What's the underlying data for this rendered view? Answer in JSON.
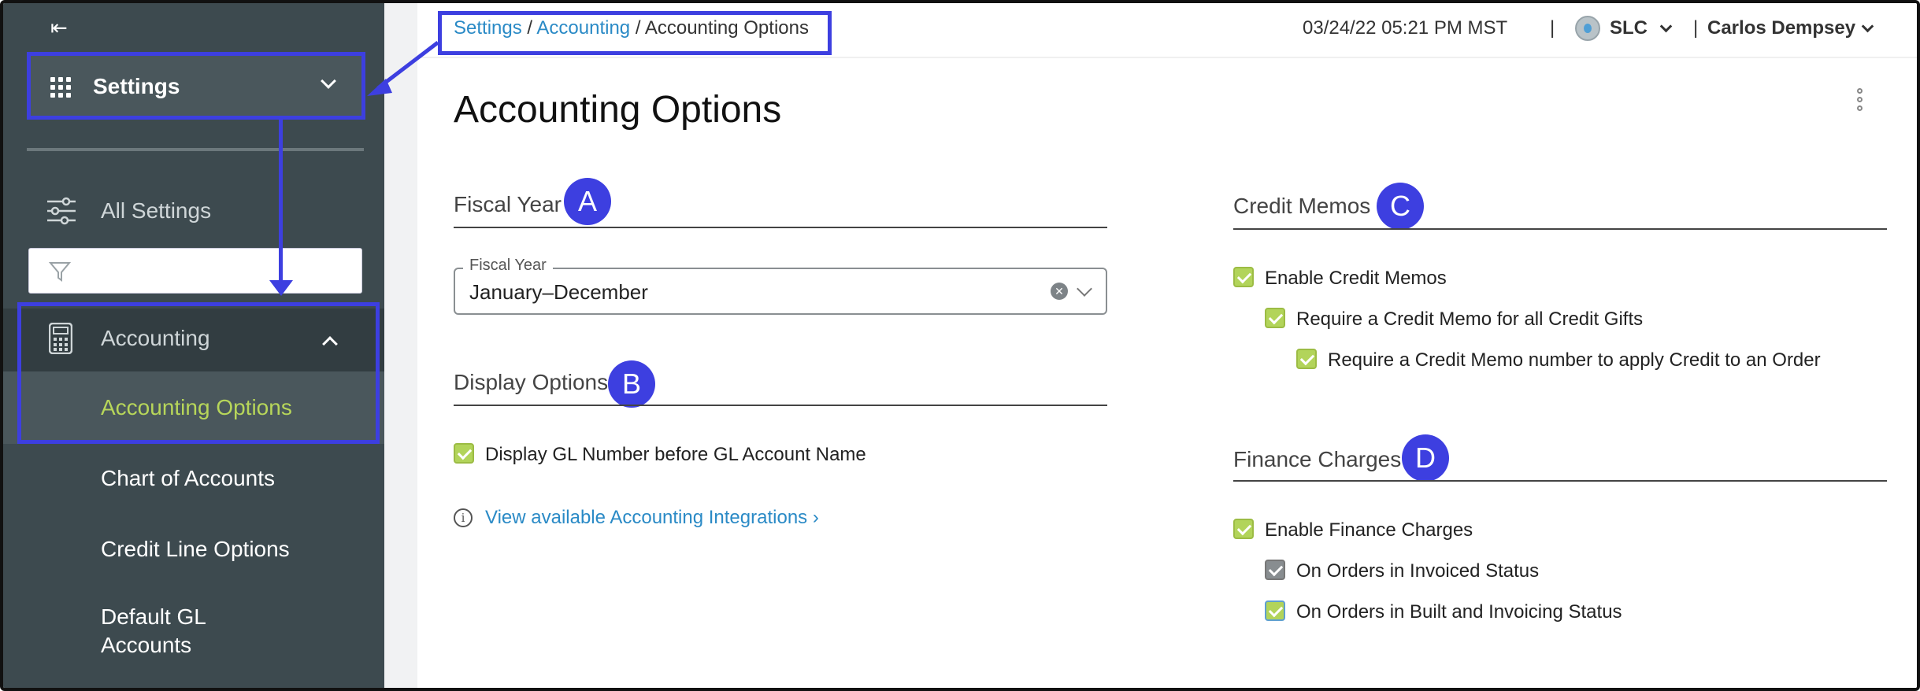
{
  "sidebar": {
    "collapse_glyph": "⇤",
    "menu_title": "Settings",
    "all_settings": "All Settings",
    "filter_placeholder": "",
    "accounting": "Accounting",
    "items": [
      "Accounting Options",
      "Chart of Accounts",
      "Credit Line Options",
      "Default GL",
      "Accounts"
    ]
  },
  "header": {
    "breadcrumb": {
      "settings": "Settings",
      "accounting": "Accounting",
      "current": "Accounting Options",
      "sep": "/"
    },
    "datetime": "03/24/22 05:21 PM MST",
    "divider": "|",
    "location": "SLC",
    "user": "Carlos Dempsey"
  },
  "page": {
    "title": "Accounting Options"
  },
  "sections": {
    "fiscal_year": {
      "title": "Fiscal Year",
      "badge": "A",
      "field_label": "Fiscal Year",
      "value": "January–December"
    },
    "display_options": {
      "title": "Display Options",
      "badge": "B",
      "gl_label": "Display GL Number before GL Account Name",
      "link": "View available Accounting Integrations",
      "link_chevron": "›"
    },
    "credit_memos": {
      "title": "Credit Memos",
      "badge": "C",
      "items": [
        "Enable Credit Memos",
        "Require a Credit Memo for all Credit Gifts",
        "Require a Credit Memo number to apply Credit to an Order"
      ]
    },
    "finance_charges": {
      "title": "Finance Charges",
      "badge": "D",
      "items": [
        "Enable Finance Charges",
        "On Orders in Invoiced Status",
        "On Orders in Built and Invoicing Status"
      ]
    }
  },
  "colors": {
    "accent": "#3d3fe0",
    "sidebar": "#3d4a4f",
    "active": "#b7d65a",
    "link": "#2a8ac6"
  }
}
